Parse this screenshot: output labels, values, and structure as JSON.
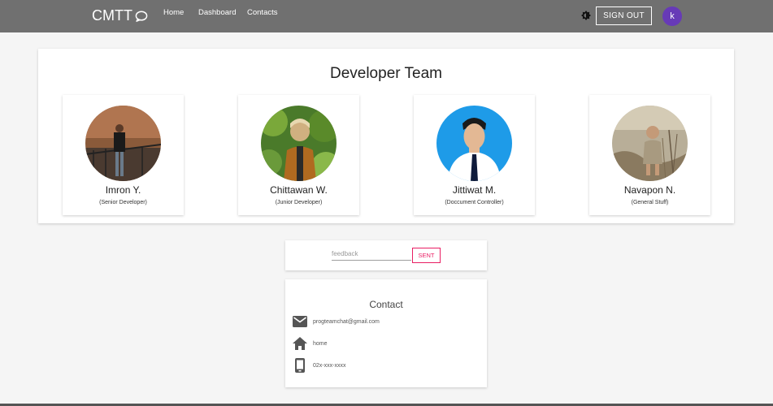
{
  "header": {
    "brand": "CMTT",
    "nav": [
      "Home",
      "Dashboard",
      "Contacts"
    ],
    "theme_icon": "brightness-icon",
    "signout_label": "SIGN OUT",
    "avatar_letter": "k",
    "colors": {
      "bar": "#707070",
      "avatar": "#673ab7"
    }
  },
  "team": {
    "title": "Developer Team",
    "members": [
      {
        "name": "Imron Y.",
        "role": "(Senior Developer)"
      },
      {
        "name": "Chittawan W.",
        "role": "(Junior Developer)"
      },
      {
        "name": "Jittiwat M.",
        "role": "(Doccument Controller)"
      },
      {
        "name": "Navapon N.",
        "role": "(General Stuff)"
      }
    ]
  },
  "feedback": {
    "placeholder": "feedback",
    "send_label": "SENT",
    "accent": "#e91e63"
  },
  "contact": {
    "title": "Contact",
    "items": [
      {
        "icon": "email-icon",
        "text": "progteamchat@gmail.com"
      },
      {
        "icon": "home-icon",
        "text": "home"
      },
      {
        "icon": "phone-icon",
        "text": "02x-xxx-xxxx"
      }
    ]
  }
}
